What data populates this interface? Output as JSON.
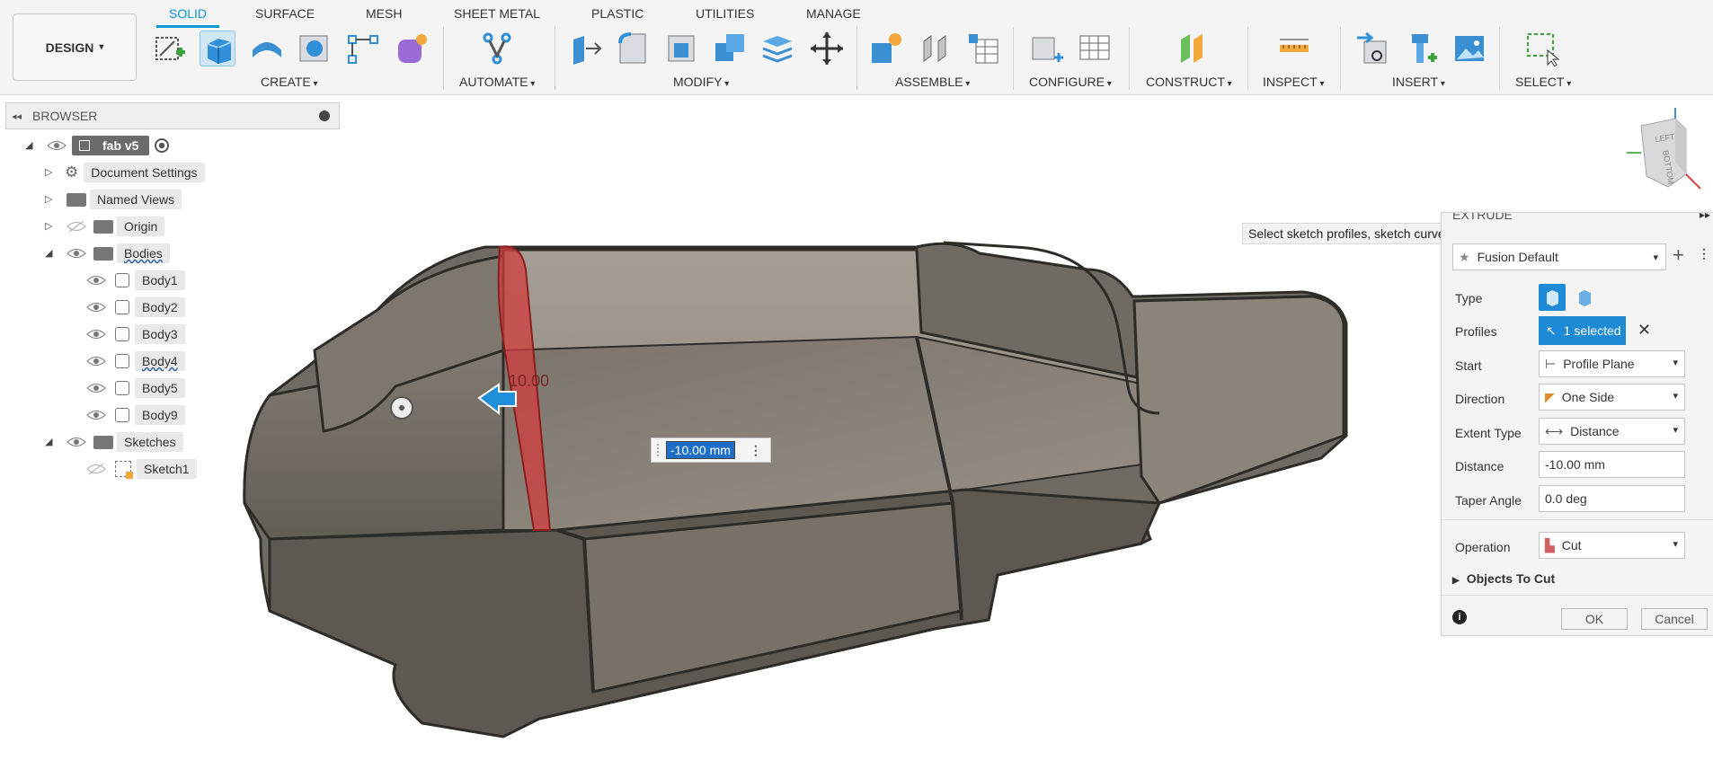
{
  "toolbar": {
    "design_label": "DESIGN",
    "tabs": [
      "SOLID",
      "SURFACE",
      "MESH",
      "SHEET METAL",
      "PLASTIC",
      "UTILITIES",
      "MANAGE"
    ],
    "groups": [
      "CREATE",
      "AUTOMATE",
      "MODIFY",
      "ASSEMBLE",
      "CONFIGURE",
      "CONSTRUCT",
      "INSPECT",
      "INSERT",
      "SELECT"
    ]
  },
  "browser": {
    "title": "BROWSER",
    "root": "fab v5",
    "items": [
      {
        "label": "Document Settings"
      },
      {
        "label": "Named Views"
      },
      {
        "label": "Origin"
      },
      {
        "label": "Bodies"
      },
      {
        "label": "Body1"
      },
      {
        "label": "Body2"
      },
      {
        "label": "Body3"
      },
      {
        "label": "Body4"
      },
      {
        "label": "Body5"
      },
      {
        "label": "Body9"
      },
      {
        "label": "Sketches"
      },
      {
        "label": "Sketch1"
      }
    ]
  },
  "viewport": {
    "dimension_label": "10.00",
    "distance_input": "-10.00 mm",
    "tooltip": "Select sketch profiles, sketch curves or planar faces to extrude",
    "viewcube_left": "LEFT",
    "viewcube_bottom": "BOTTOM"
  },
  "extrude": {
    "title": "EXTRUDE",
    "preset": "Fusion Default",
    "rows": {
      "type": "Type",
      "profiles": "Profiles",
      "start": "Start",
      "direction": "Direction",
      "extent_type": "Extent Type",
      "distance": "Distance",
      "taper_angle": "Taper Angle",
      "operation": "Operation"
    },
    "values": {
      "profiles": "1 selected",
      "start": "Profile Plane",
      "direction": "One Side",
      "extent_type": "Distance",
      "distance": "-10.00 mm",
      "taper_angle": "0.0 deg",
      "operation": "Cut"
    },
    "objects_to_cut": "Objects To Cut",
    "ok": "OK",
    "cancel": "Cancel"
  },
  "colors": {
    "accent": "#0696d7",
    "model": "#7b756d",
    "selection": "#d23c3c"
  }
}
